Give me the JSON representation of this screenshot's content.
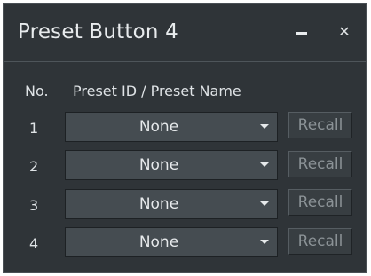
{
  "window": {
    "title": "Preset Button 4",
    "minimize_icon": "minimize-icon",
    "close_label": "✕"
  },
  "table": {
    "headers": {
      "no": "No.",
      "preset": "Preset ID / Preset Name"
    },
    "rows": [
      {
        "number": "1",
        "preset": "None",
        "action": "Recall"
      },
      {
        "number": "2",
        "preset": "None",
        "action": "Recall"
      },
      {
        "number": "3",
        "preset": "None",
        "action": "Recall"
      },
      {
        "number": "4",
        "preset": "None",
        "action": "Recall"
      }
    ]
  },
  "colors": {
    "panel": "#2f3438",
    "select_bg": "#454c51",
    "recall_text_disabled": "#8b9296"
  }
}
